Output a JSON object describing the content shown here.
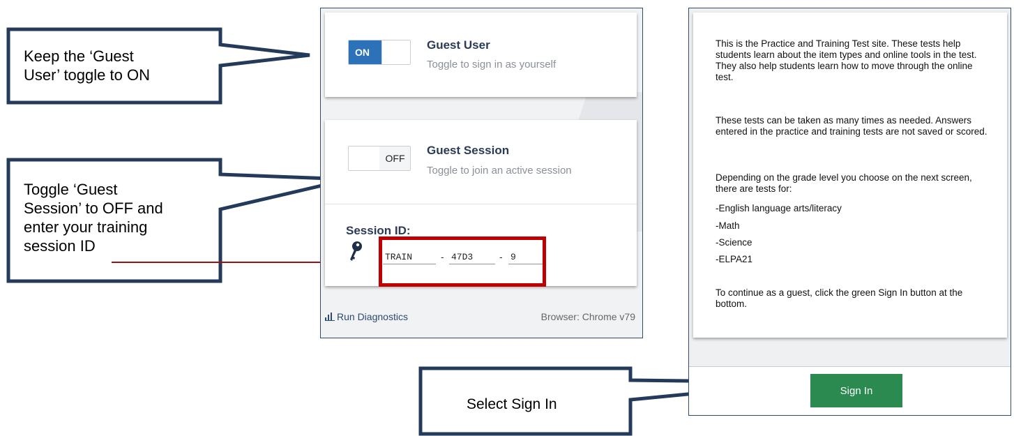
{
  "callouts": {
    "guest_user": {
      "line1": "Keep the ‘Guest",
      "line2": "User’ toggle to ON"
    },
    "guest_session": {
      "line1": "Toggle ‘Guest",
      "line2": "Session’ to OFF and",
      "line3": "enter your training",
      "line4": "session ID"
    },
    "sign_in": {
      "text": "Select Sign In"
    }
  },
  "login_panel": {
    "guest_user": {
      "toggle_state": "ON",
      "title": "Guest User",
      "subtitle": "Toggle to sign in as yourself"
    },
    "guest_session": {
      "toggle_state": "OFF",
      "title": "Guest Session",
      "subtitle": "Toggle to join an active session"
    },
    "session": {
      "label": "Session ID:",
      "part1": "TRAIN",
      "part2": "47D3",
      "part3": "9",
      "separator": "-"
    },
    "footer": {
      "diagnostics_label": "Run Diagnostics",
      "browser_label": "Browser: Chrome v79"
    }
  },
  "info_panel": {
    "para1": "This is the Practice and Training Test site. These tests help students learn about the item types and online tools in the test. They also help students learn how to move through the online test.",
    "para2": "These tests can be taken as many times as needed. Answers entered in the practice and training tests are not saved or scored.",
    "para3": "Depending on the grade level you choose on the next screen, there are tests for:",
    "list": [
      "-English language arts/literacy",
      "-Math",
      "-Science",
      "-ELPA21"
    ],
    "para4": "To continue as a guest, click the green Sign In button at the bottom.",
    "sign_in_label": "Sign In"
  },
  "colors": {
    "callout_border": "#233a5a",
    "highlight_box": "#c00000",
    "arrow": "#a01010",
    "toggle_on": "#2c72b8",
    "sign_in_button": "#2a8a4f"
  }
}
